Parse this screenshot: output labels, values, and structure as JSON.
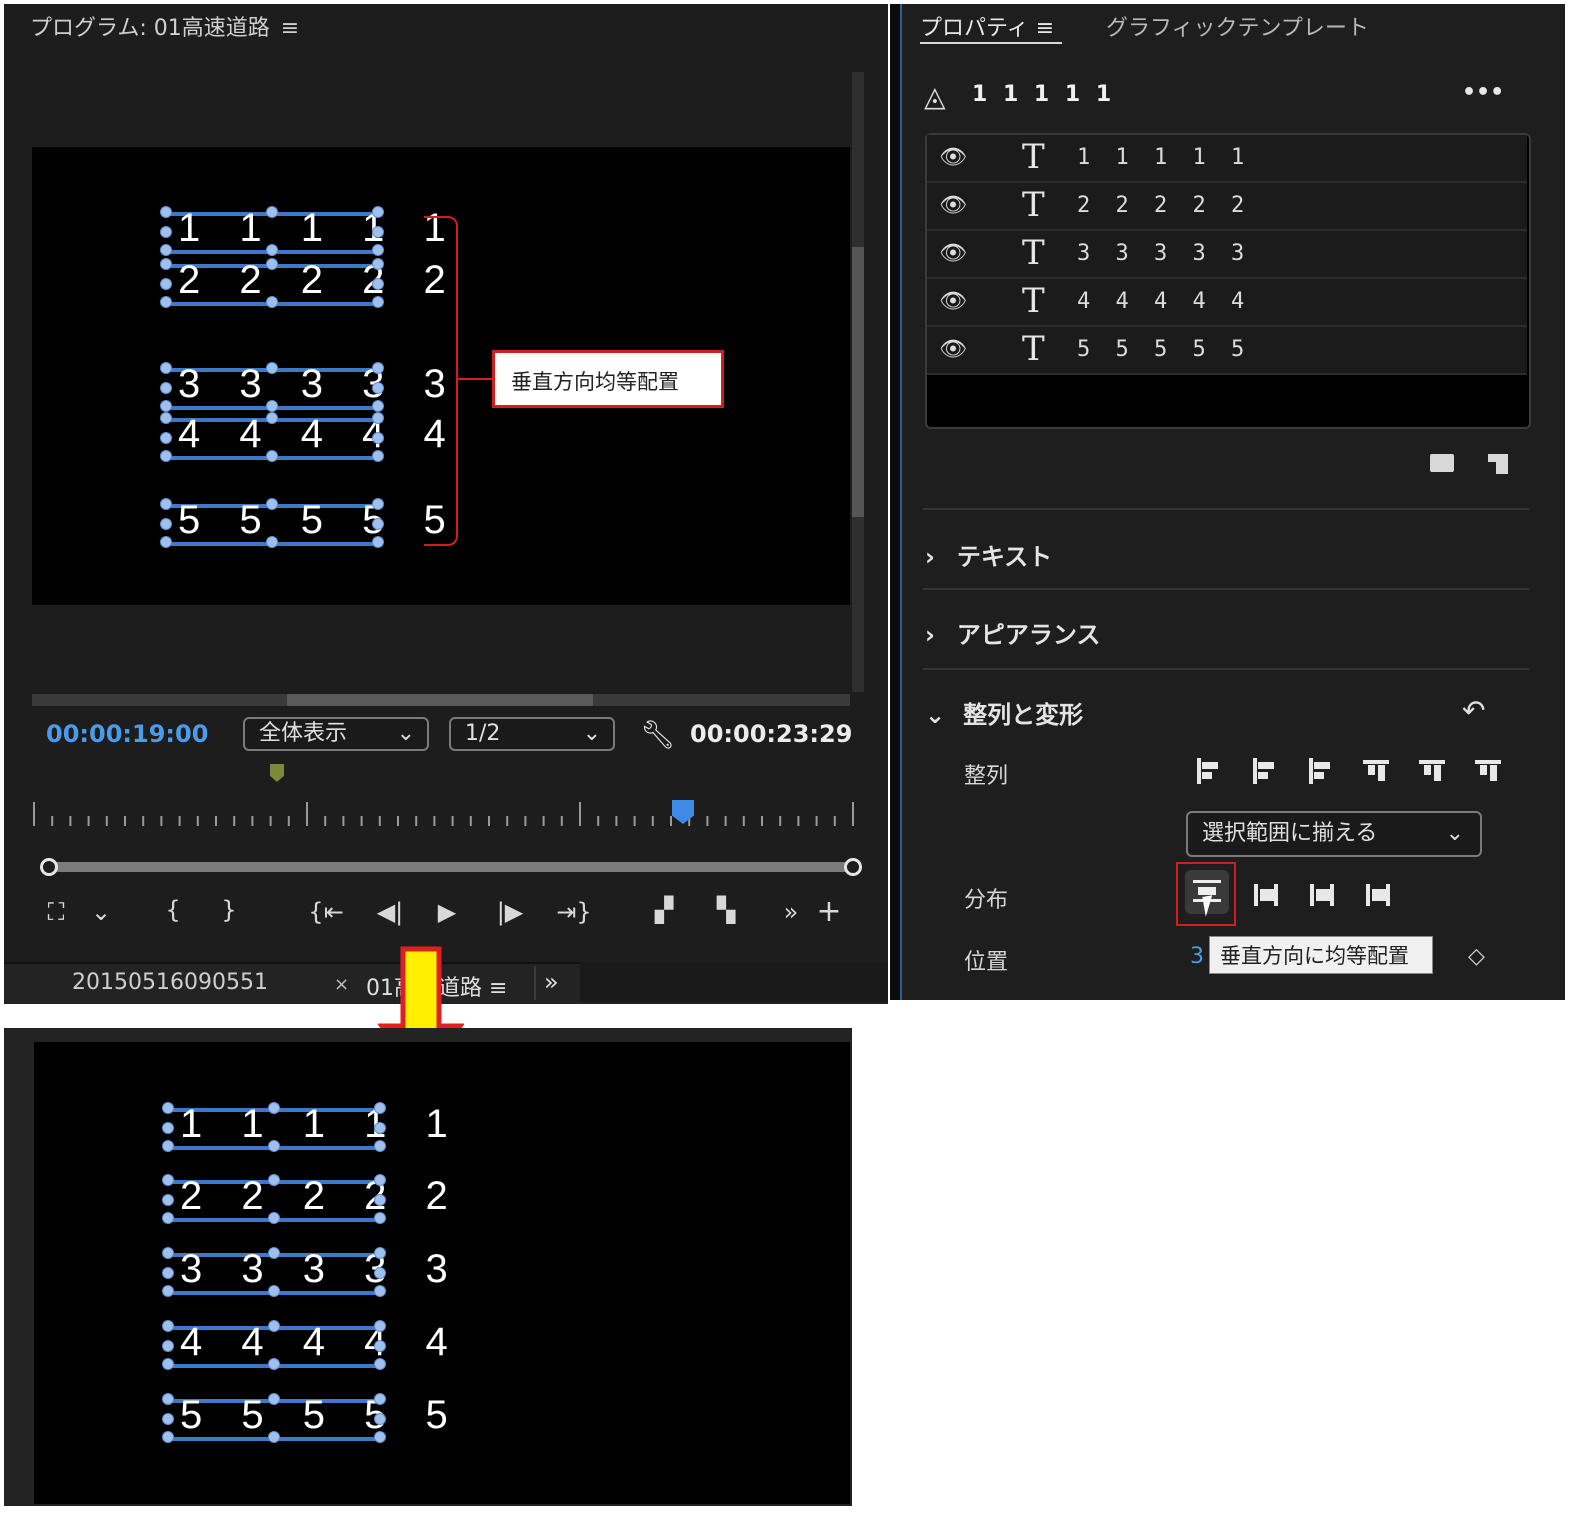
{
  "program": {
    "title": "プログラム: 01高速道路",
    "menu_icon": "hamburger-icon",
    "timecode_current": "00:00:19:00",
    "timecode_end": "00:00:23:29",
    "zoom_select": "全体表示",
    "resolution_select": "1/2"
  },
  "monitor_before": {
    "lines": [
      "1 1 1 1 1",
      "2 2 2 2 2",
      "3 3 3 3 3",
      "4 4 4 4 4",
      "5 5 5 5 5"
    ],
    "callout": "垂直方向均等配置"
  },
  "tabs_bottom": {
    "tab1": "20150516090551",
    "tab1_close": "×",
    "tab2": "01高速道路",
    "more": "»"
  },
  "properties": {
    "tab_active": "プロパティ",
    "tab_other": "グラフィックテンプレート",
    "clip_name": "1 1 1 1 1",
    "more": "•••",
    "layers": [
      {
        "name": "1 1 1 1 1"
      },
      {
        "name": "2 2 2 2 2"
      },
      {
        "name": "3 3 3 3 3"
      },
      {
        "name": "4 4 4 4 4"
      },
      {
        "name": "5 5 5 5 5"
      }
    ],
    "section_text": "テキスト",
    "section_appearance": "アピアランス",
    "section_align": "整列と変形",
    "align_label": "整列",
    "align_to_select": "選択範囲に揃える",
    "distribute_label": "分布",
    "position_label": "位置",
    "position_value": "3",
    "tooltip": "垂直方向に均等配置"
  },
  "monitor_after": {
    "lines": [
      "1 1 1 1 1",
      "2 2 2 2 2",
      "3 3 3 3 3",
      "4 4 4 4 4",
      "5 5 5 5 5"
    ]
  },
  "colors": {
    "timecode_blue": "#4b9bec",
    "callout_red": "#d21e1e",
    "arrow_yellow": "#ffee00",
    "arrow_red": "#e02020"
  }
}
